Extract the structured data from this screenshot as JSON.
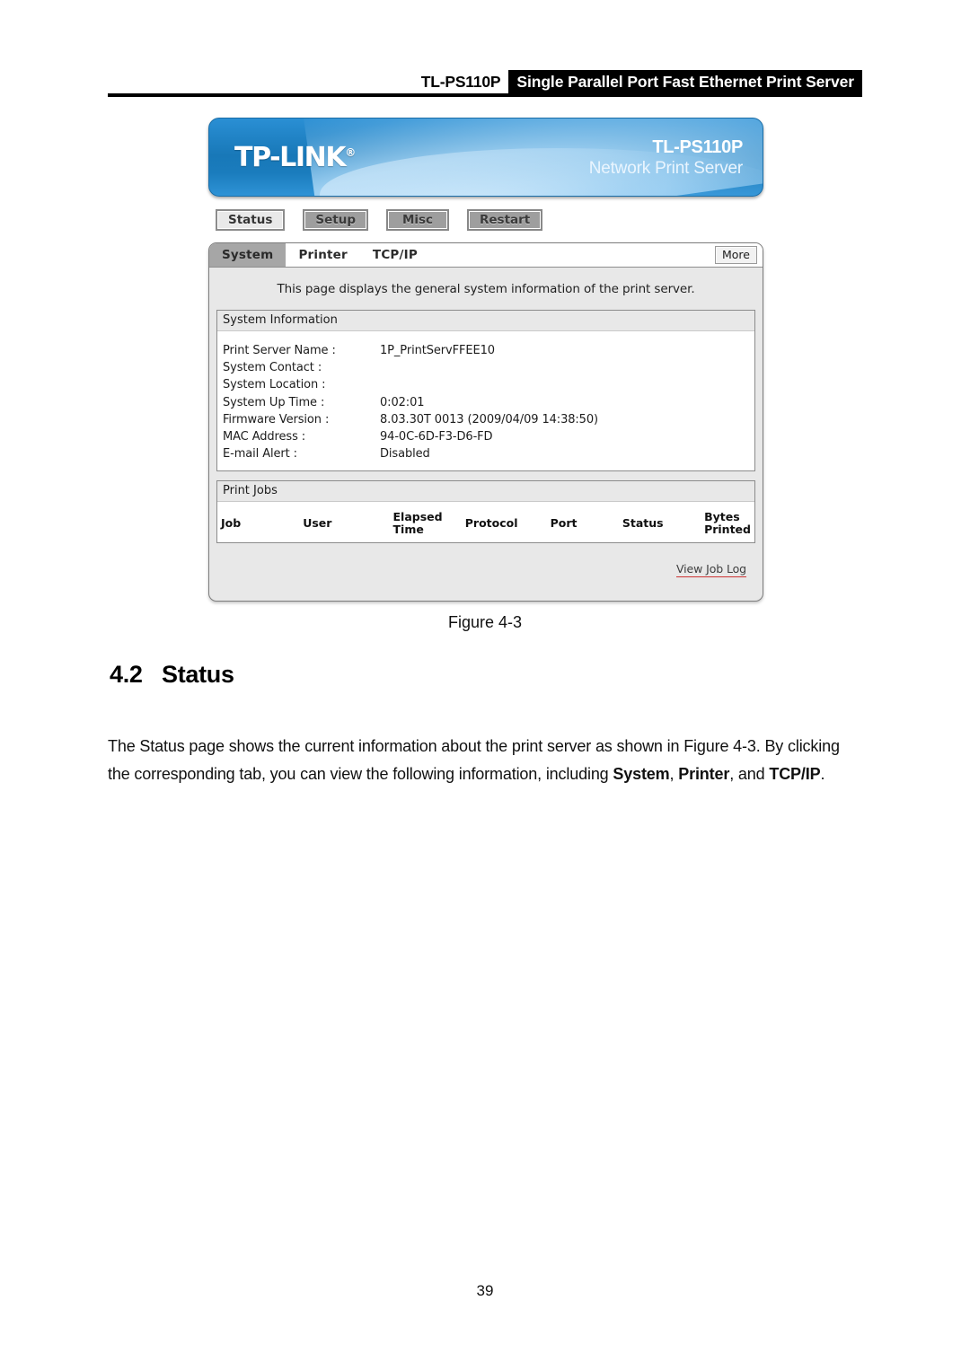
{
  "document": {
    "running_header": {
      "model": "TL-PS110P",
      "title": "Single Parallel Port Fast Ethernet Print Server"
    },
    "figure_caption": "Figure 4-3",
    "section": {
      "number": "4.2",
      "title": "Status"
    },
    "paragraph": {
      "part1": "The Status page shows the current information about the print server as shown in Figure 4-3. By clicking the corresponding tab, you can view the following information, including ",
      "bold1": "System",
      "sep1": ", ",
      "bold2": "Printer",
      "sep2": ", and ",
      "bold3": "TCP/IP",
      "end": "."
    },
    "page_number": "39"
  },
  "print_server_ui": {
    "banner": {
      "brand": "TP-LINK",
      "brand_mark": "®",
      "model": "TL-PS110P",
      "subtitle": "Network Print Server",
      "gradient_start": "#2a8fd4",
      "gradient_end": "#1878b8"
    },
    "nav_buttons": [
      {
        "label": "Status",
        "active": true
      },
      {
        "label": "Setup",
        "active": false
      },
      {
        "label": "Misc",
        "active": false
      },
      {
        "label": "Restart",
        "active": false
      }
    ],
    "tabs": [
      {
        "label": "System",
        "active": true
      },
      {
        "label": "Printer",
        "active": false
      },
      {
        "label": "TCP/IP",
        "active": false
      }
    ],
    "more_button": "More",
    "page_description": "This page displays the general system information of the print server.",
    "system_information": {
      "section_title": "System Information",
      "rows": [
        {
          "label": "Print Server Name :",
          "value": "1P_PrintServFFEE10"
        },
        {
          "label": "System Contact :",
          "value": ""
        },
        {
          "label": "System Location :",
          "value": ""
        },
        {
          "label": "System Up Time :",
          "value": "0:02:01"
        },
        {
          "label": "Firmware Version :",
          "value": "8.03.30T 0013 (2009/04/09 14:38:50)"
        },
        {
          "label": "MAC Address :",
          "value": "94-0C-6D-F3-D6-FD"
        },
        {
          "label": "E-mail Alert :",
          "value": "Disabled"
        }
      ]
    },
    "print_jobs": {
      "section_title": "Print Jobs",
      "columns": {
        "job": "Job",
        "user": "User",
        "elapsed_line1": "Elapsed",
        "elapsed_line2": "Time",
        "protocol": "Protocol",
        "port": "Port",
        "status": "Status",
        "bytes_line1": "Bytes",
        "bytes_line2": "Printed"
      },
      "rows": [],
      "view_job_log_link": "View Job Log",
      "link_underline_color": "#cc3333"
    }
  }
}
